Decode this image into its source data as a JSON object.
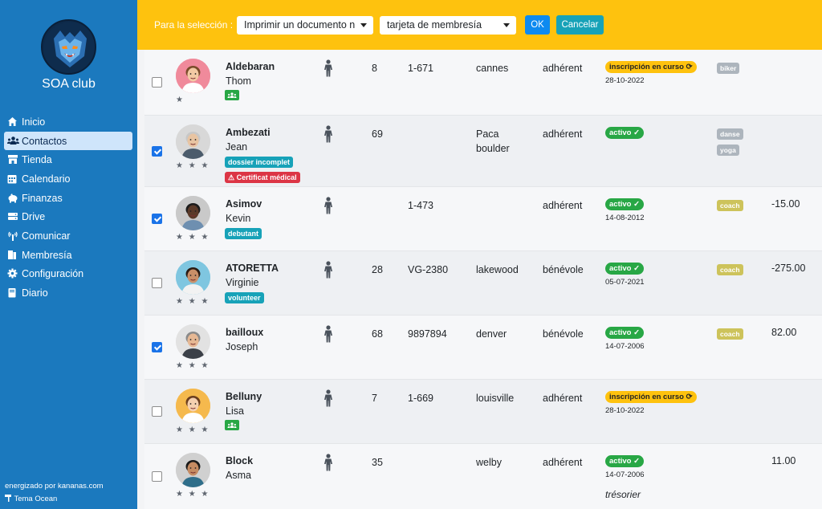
{
  "sidebar": {
    "club_name": "SOA club",
    "items": [
      {
        "label": "Inicio",
        "icon": "home-icon",
        "active": false
      },
      {
        "label": "Contactos",
        "icon": "users-icon",
        "active": true
      },
      {
        "label": "Tienda",
        "icon": "store-icon",
        "active": false
      },
      {
        "label": "Calendario",
        "icon": "calendar-icon",
        "active": false
      },
      {
        "label": "Finanzas",
        "icon": "piggy-bank-icon",
        "active": false
      },
      {
        "label": "Drive",
        "icon": "drive-icon",
        "active": false
      },
      {
        "label": "Comunicar",
        "icon": "broadcast-icon",
        "active": false
      },
      {
        "label": "Membresía",
        "icon": "membership-icon",
        "active": false
      },
      {
        "label": "Configuración",
        "icon": "gear-icon",
        "active": false
      },
      {
        "label": "Diario",
        "icon": "book-icon",
        "active": false
      }
    ],
    "footer_powered": "energizado por kananas.com",
    "footer_theme": "Tema Ocean"
  },
  "toolbar": {
    "selection_label": "Para la selección :",
    "action_select": "Imprimir un documento n",
    "document_select": "tarjeta de membresía",
    "ok_label": "OK",
    "cancel_label": "Cancelar"
  },
  "colors": {
    "sidebar_bg": "#1b79be",
    "topbar_bg": "#fec20e",
    "ok_button": "#0d8af0",
    "cancel_button": "#17a2b8"
  },
  "contacts": [
    {
      "last": "Aldebaran",
      "first": "Thom",
      "stars": "★",
      "checked": false,
      "tags": [
        {
          "type": "group"
        }
      ],
      "age": "8",
      "member_id": "1-671",
      "city": "cannes",
      "role": "adhérent",
      "status": "inscripción en curso",
      "status_type": "pending",
      "date": "28-10-2022",
      "activities": [
        "biker"
      ],
      "activity_type": "grey",
      "amount": "",
      "note": ""
    },
    {
      "last": "Ambezati",
      "first": "Jean",
      "stars": "★ ★ ★",
      "checked": true,
      "tags": [
        {
          "type": "text",
          "label": "dossier incomplet",
          "color": "teal"
        },
        {
          "type": "text",
          "label": "⚠ Certificat médical",
          "color": "red"
        }
      ],
      "age": "69",
      "member_id": "",
      "city": "Paca boulder",
      "role": "adhérent",
      "status": "activo ✓",
      "status_type": "active",
      "date": "",
      "activities": [
        "danse",
        "yoga"
      ],
      "activity_type": "grey",
      "amount": "",
      "note": ""
    },
    {
      "last": "Asimov",
      "first": "Kevin",
      "stars": "★ ★ ★",
      "checked": true,
      "tags": [
        {
          "type": "text",
          "label": "debutant",
          "color": "teal"
        }
      ],
      "age": "",
      "member_id": "1-473",
      "city": "",
      "role": "adhérent",
      "status": "activo ✓",
      "status_type": "active",
      "date": "14-08-2012",
      "activities": [
        "coach"
      ],
      "activity_type": "olive",
      "amount": "-15.00",
      "note": ""
    },
    {
      "last": "ATORETTA",
      "first": "Virginie",
      "stars": "★ ★ ★",
      "checked": false,
      "tags": [
        {
          "type": "text",
          "label": "volunteer",
          "color": "teal"
        }
      ],
      "age": "28",
      "member_id": "VG-2380",
      "city": "lakewood",
      "role": "bénévole",
      "status": "activo ✓",
      "status_type": "active",
      "date": "05-07-2021",
      "activities": [
        "coach"
      ],
      "activity_type": "olive",
      "amount": "-275.00",
      "note": ""
    },
    {
      "last": "bailloux",
      "first": "Joseph",
      "stars": "★ ★ ★",
      "checked": true,
      "tags": [],
      "age": "68",
      "member_id": "9897894",
      "city": "denver",
      "role": "bénévole",
      "status": "activo ✓",
      "status_type": "active",
      "date": "14-07-2006",
      "activities": [
        "coach"
      ],
      "activity_type": "olive",
      "amount": "82.00",
      "note": ""
    },
    {
      "last": "Belluny",
      "first": "Lisa",
      "stars": "★ ★ ★",
      "checked": false,
      "tags": [
        {
          "type": "group"
        }
      ],
      "age": "7",
      "member_id": "1-669",
      "city": "louisville",
      "role": "adhérent",
      "status": "inscripción en curso",
      "status_type": "pending",
      "date": "28-10-2022",
      "activities": [],
      "activity_type": "grey",
      "amount": "",
      "note": ""
    },
    {
      "last": "Block",
      "first": "Asma",
      "stars": "★ ★ ★",
      "checked": false,
      "tags": [],
      "age": "35",
      "member_id": "",
      "city": "welby",
      "role": "adhérent",
      "status": "activo ✓",
      "status_type": "active",
      "date": "14-07-2006",
      "activities": [],
      "activity_type": "grey",
      "amount": "11.00",
      "note": "trésorier"
    }
  ]
}
